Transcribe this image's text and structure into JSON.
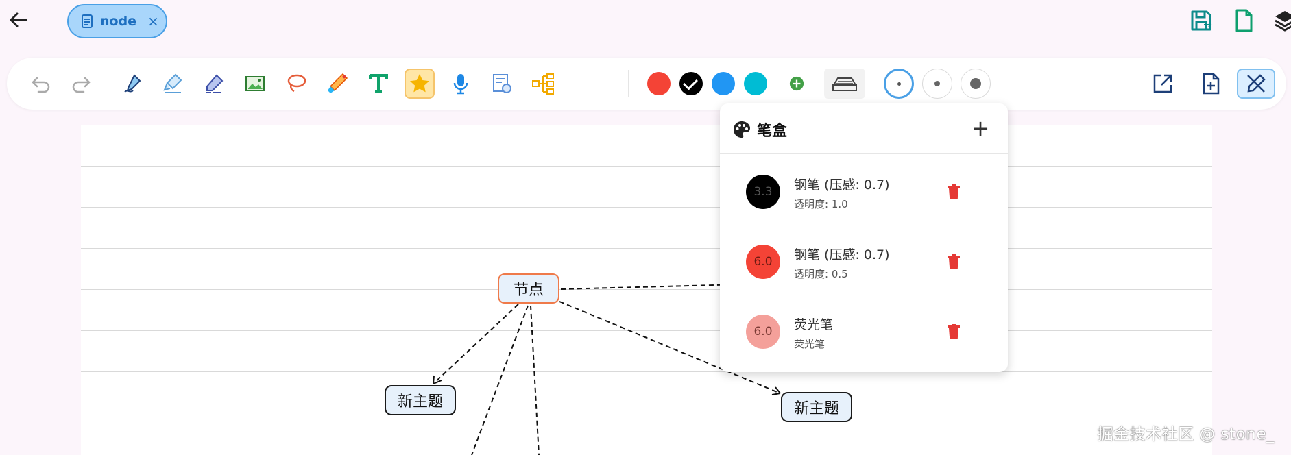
{
  "tab": {
    "label": "node",
    "close_glyph": "×"
  },
  "icons": {
    "back": "arrow-left-icon",
    "doc": "document-icon",
    "save": "save-icon",
    "new_file": "file-icon",
    "layers": "layers-icon"
  },
  "toolbar": {
    "tools": [
      "undo",
      "redo",
      "fountain-pen",
      "highlighter",
      "eraser",
      "image",
      "lasso",
      "laser-pointer",
      "text",
      "star",
      "microphone",
      "stamp",
      "mindmap"
    ],
    "colors": [
      "#f44336",
      "#000000",
      "#2196f3",
      "#00bcd4"
    ],
    "accent": "#4aa0e6"
  },
  "canvas": {
    "nodes": [
      {
        "id": "root",
        "label": "节点"
      },
      {
        "id": "left",
        "label": "新主题"
      },
      {
        "id": "right",
        "label": "新主题"
      }
    ]
  },
  "penbox": {
    "title": "笔盒",
    "add_glyph": "+",
    "items": [
      {
        "size": "3.3",
        "name": "钢笔 (压感: 0.7)",
        "sub": "透明度: 1.0",
        "color": "#000000",
        "text_color": "#555555"
      },
      {
        "size": "6.0",
        "name": "钢笔 (压感: 0.7)",
        "sub": "透明度: 0.5",
        "color": "#f44336",
        "text_color": "#6b1a12"
      },
      {
        "size": "6.0",
        "name": "荧光笔",
        "sub": "荧光笔",
        "color": "#f4a09a",
        "text_color": "#7a3a34"
      }
    ],
    "delete_color": "#e53935"
  },
  "watermark": "掘金技术社区 @ stone_"
}
